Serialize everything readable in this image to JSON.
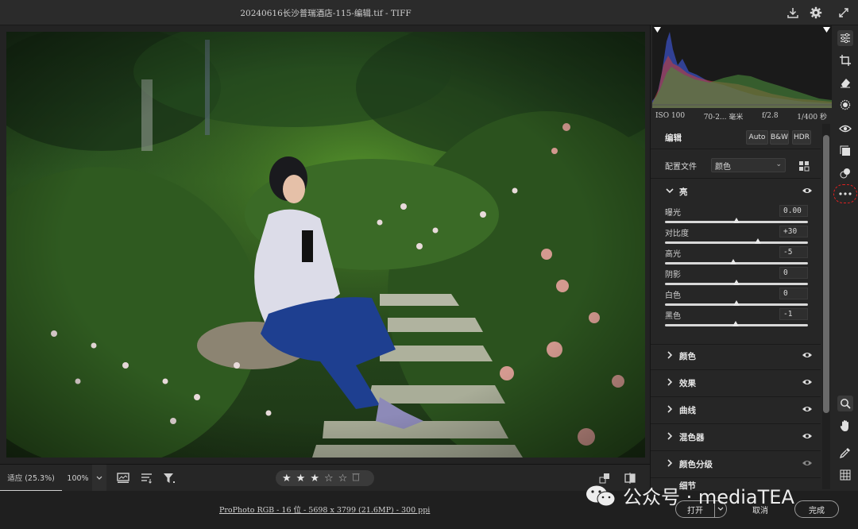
{
  "window": {
    "title": "20240616长沙普瑞酒店-115-编辑.tif -  TIFF"
  },
  "toolbar_bottom": {
    "zoom_fit": "适应 (25.3%)",
    "zoom_100": "100%",
    "rating": {
      "filled": 3,
      "total": 5
    }
  },
  "status": {
    "file_info": "ProPhoto RGB - 16 位 - 5698 x 3799 (21.6MP) - 300 ppi",
    "open": "打开",
    "cancel": "取消",
    "done": "完成"
  },
  "watermark": "公众号 · mediaTEA",
  "histogram": {
    "iso": "ISO 100",
    "lens": "70-2... 毫米",
    "aperture": "f/2.8",
    "shutter": "1/400 秒"
  },
  "edit": {
    "label": "编辑",
    "auto": "Auto",
    "bw": "B&W",
    "hdr": "HDR",
    "profile_label": "配置文件",
    "profile_value": "颜色"
  },
  "light": {
    "label": "亮",
    "sliders": [
      {
        "label": "曝光",
        "value": "0.00",
        "pos": 0.5
      },
      {
        "label": "对比度",
        "value": "+30",
        "pos": 0.65
      },
      {
        "label": "高光",
        "value": "-5",
        "pos": 0.475
      },
      {
        "label": "阴影",
        "value": "0",
        "pos": 0.5
      },
      {
        "label": "白色",
        "value": "0",
        "pos": 0.5
      },
      {
        "label": "黑色",
        "value": "-1",
        "pos": 0.495
      }
    ]
  },
  "sections": [
    "颜色",
    "效果",
    "曲线",
    "混色器",
    "颜色分级",
    "细节"
  ],
  "colors": {
    "panel": "#262626",
    "accent_ring": "#e02020"
  }
}
